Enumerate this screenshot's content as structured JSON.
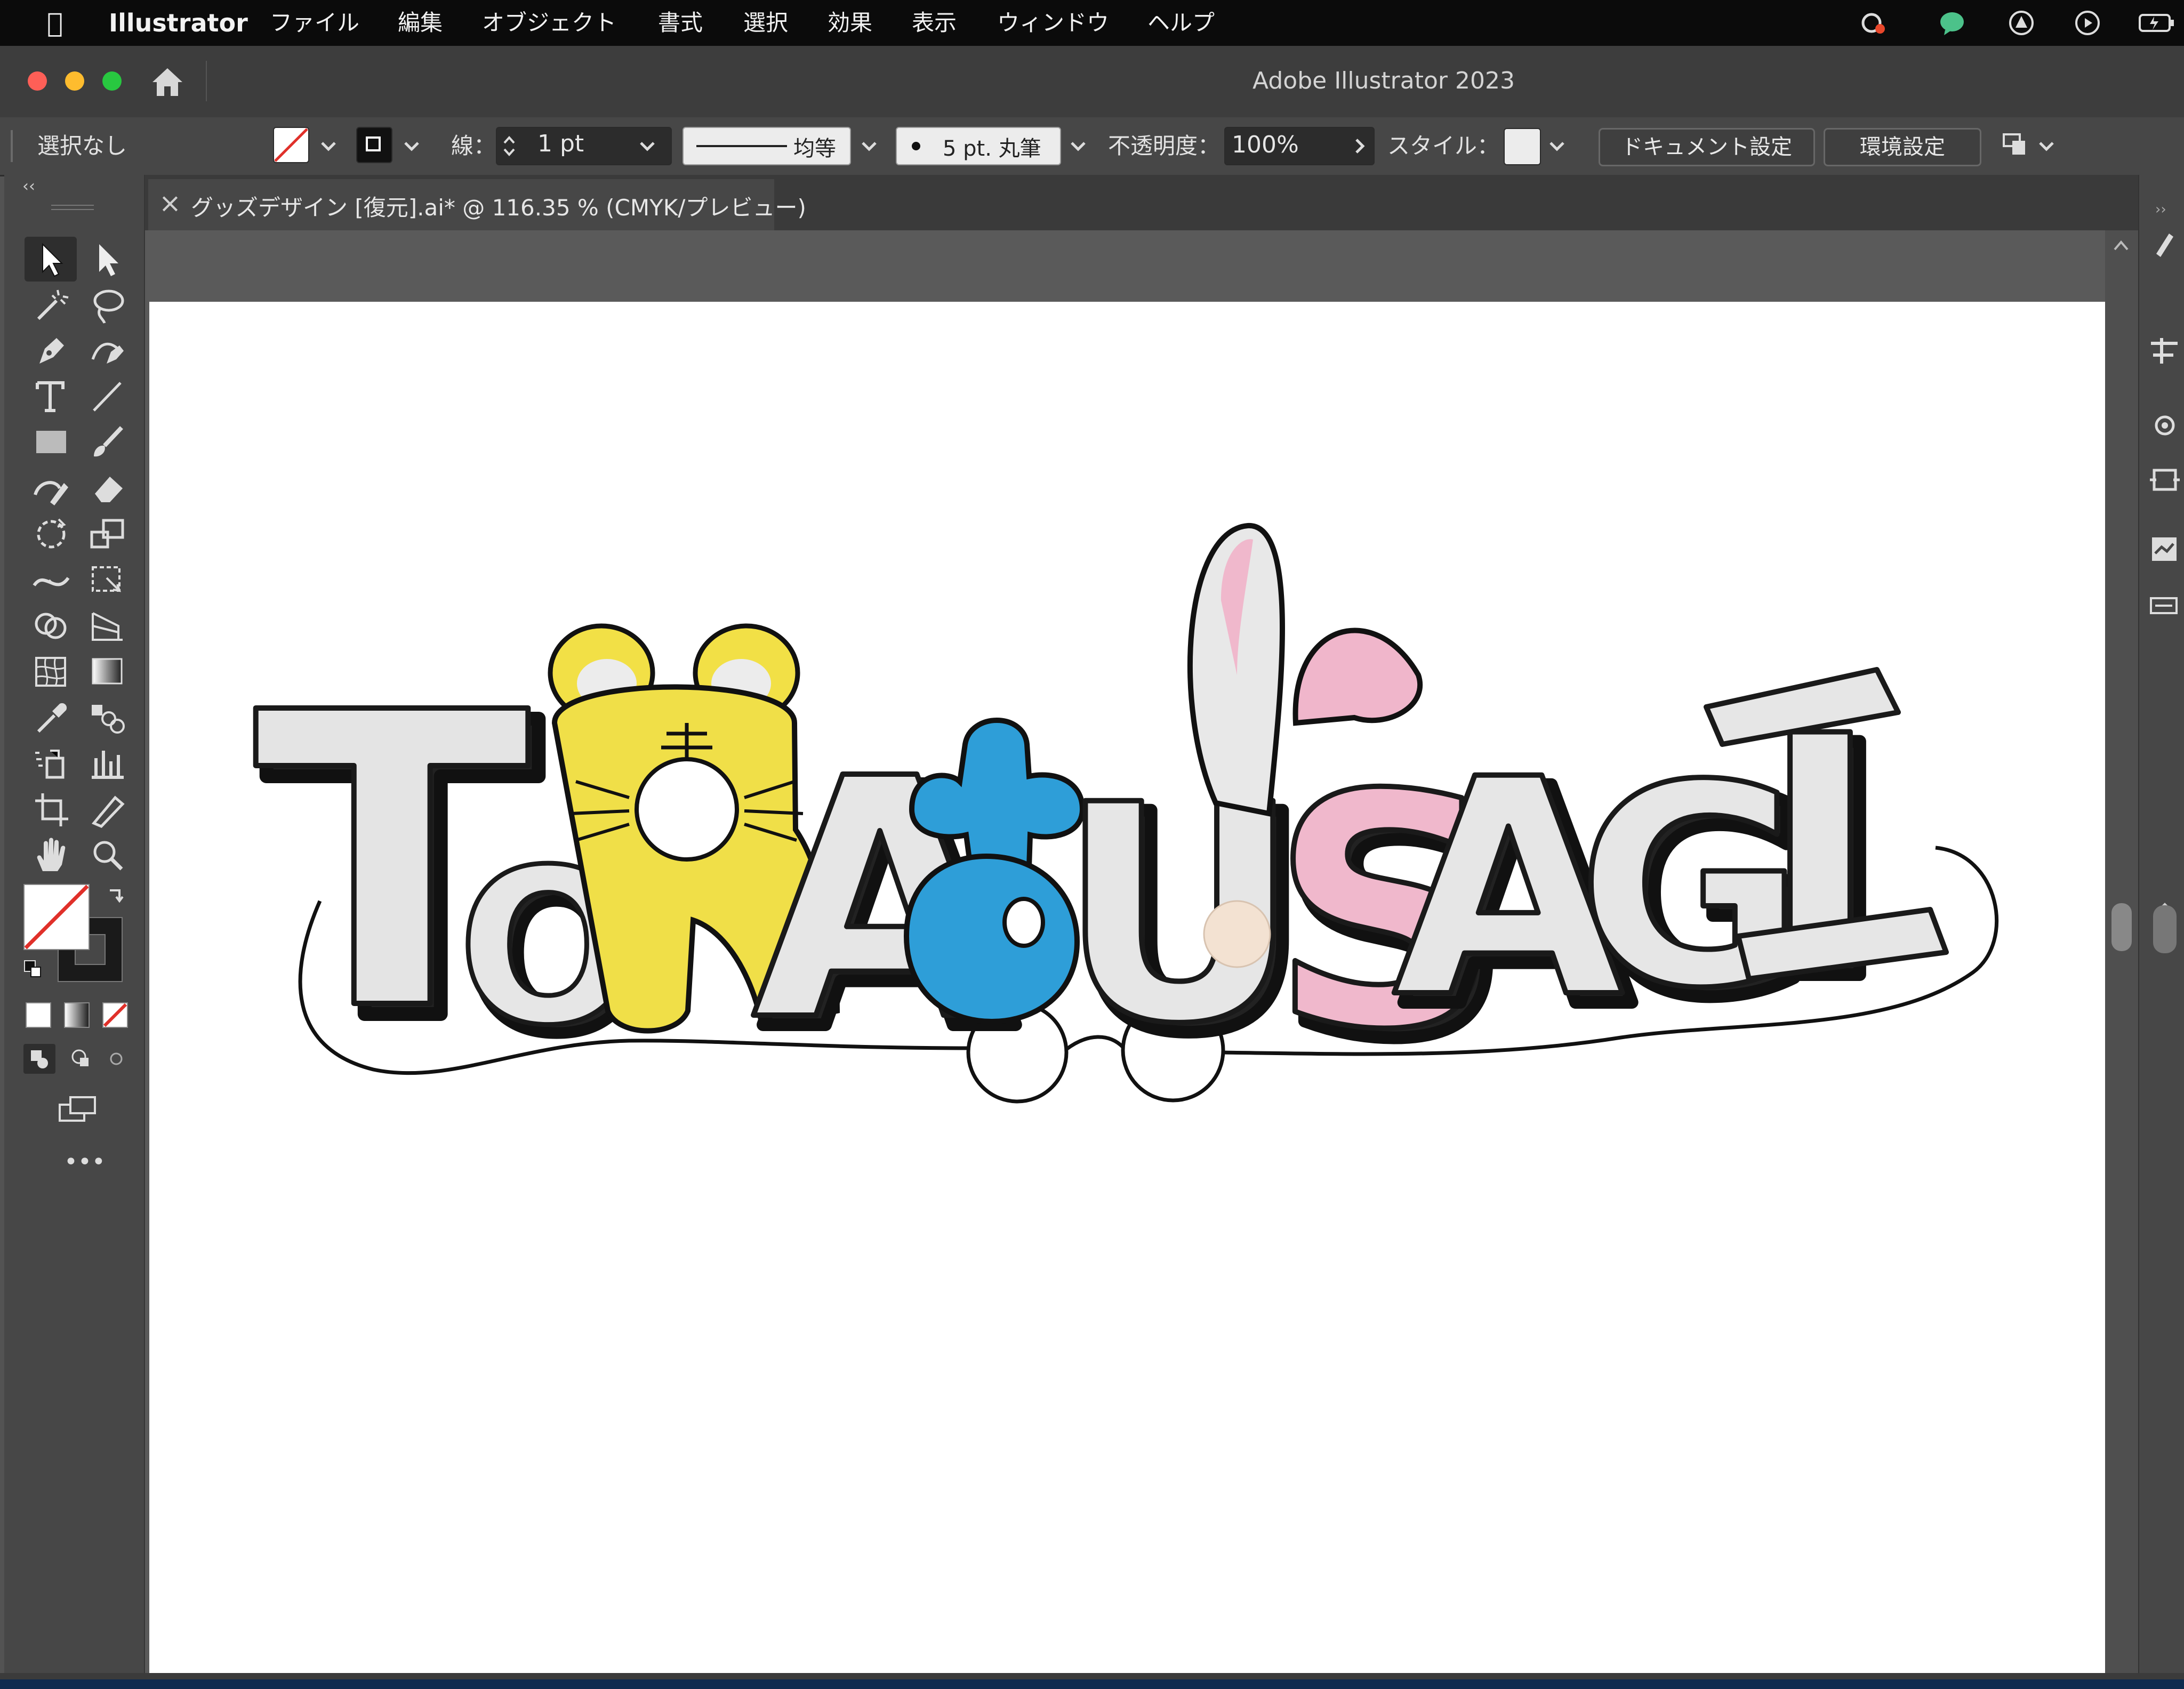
{
  "menubar": {
    "app_name": "Illustrator",
    "menus": [
      "ファイル",
      "編集",
      "オブジェクト",
      "書式",
      "選択",
      "効果",
      "表示",
      "ウィンドウ",
      "ヘルプ"
    ]
  },
  "window": {
    "title": "Adobe Illustrator 2023"
  },
  "control_bar": {
    "selection_status": "選択なし",
    "stroke_label": "線：",
    "stroke_weight": "1 pt",
    "stroke_style_label": "均等",
    "brush_label": "5 pt. 丸筆",
    "opacity_label": "不透明度：",
    "opacity_value": "100%",
    "style_label": "スタイル：",
    "document_setup_button": "ドキュメント設定",
    "preferences_button": "環境設定"
  },
  "document": {
    "tab_label": "グッズデザイン [復元].ai* @ 116.35 % (CMYK/プレビュー)"
  },
  "artwork": {
    "wordmark": "TORATOUSAGI"
  },
  "colors": {
    "menubar": "#0b0b0b",
    "panel": "#474747",
    "artboard": "#ffffff",
    "tiger_yellow": "#f0e04a",
    "blue": "#2f9fd8",
    "pink": "#f0b8cc",
    "letter_white": "#e6e6e6"
  },
  "toolbar": {
    "fill_color": "none",
    "stroke_color": "#000000"
  }
}
